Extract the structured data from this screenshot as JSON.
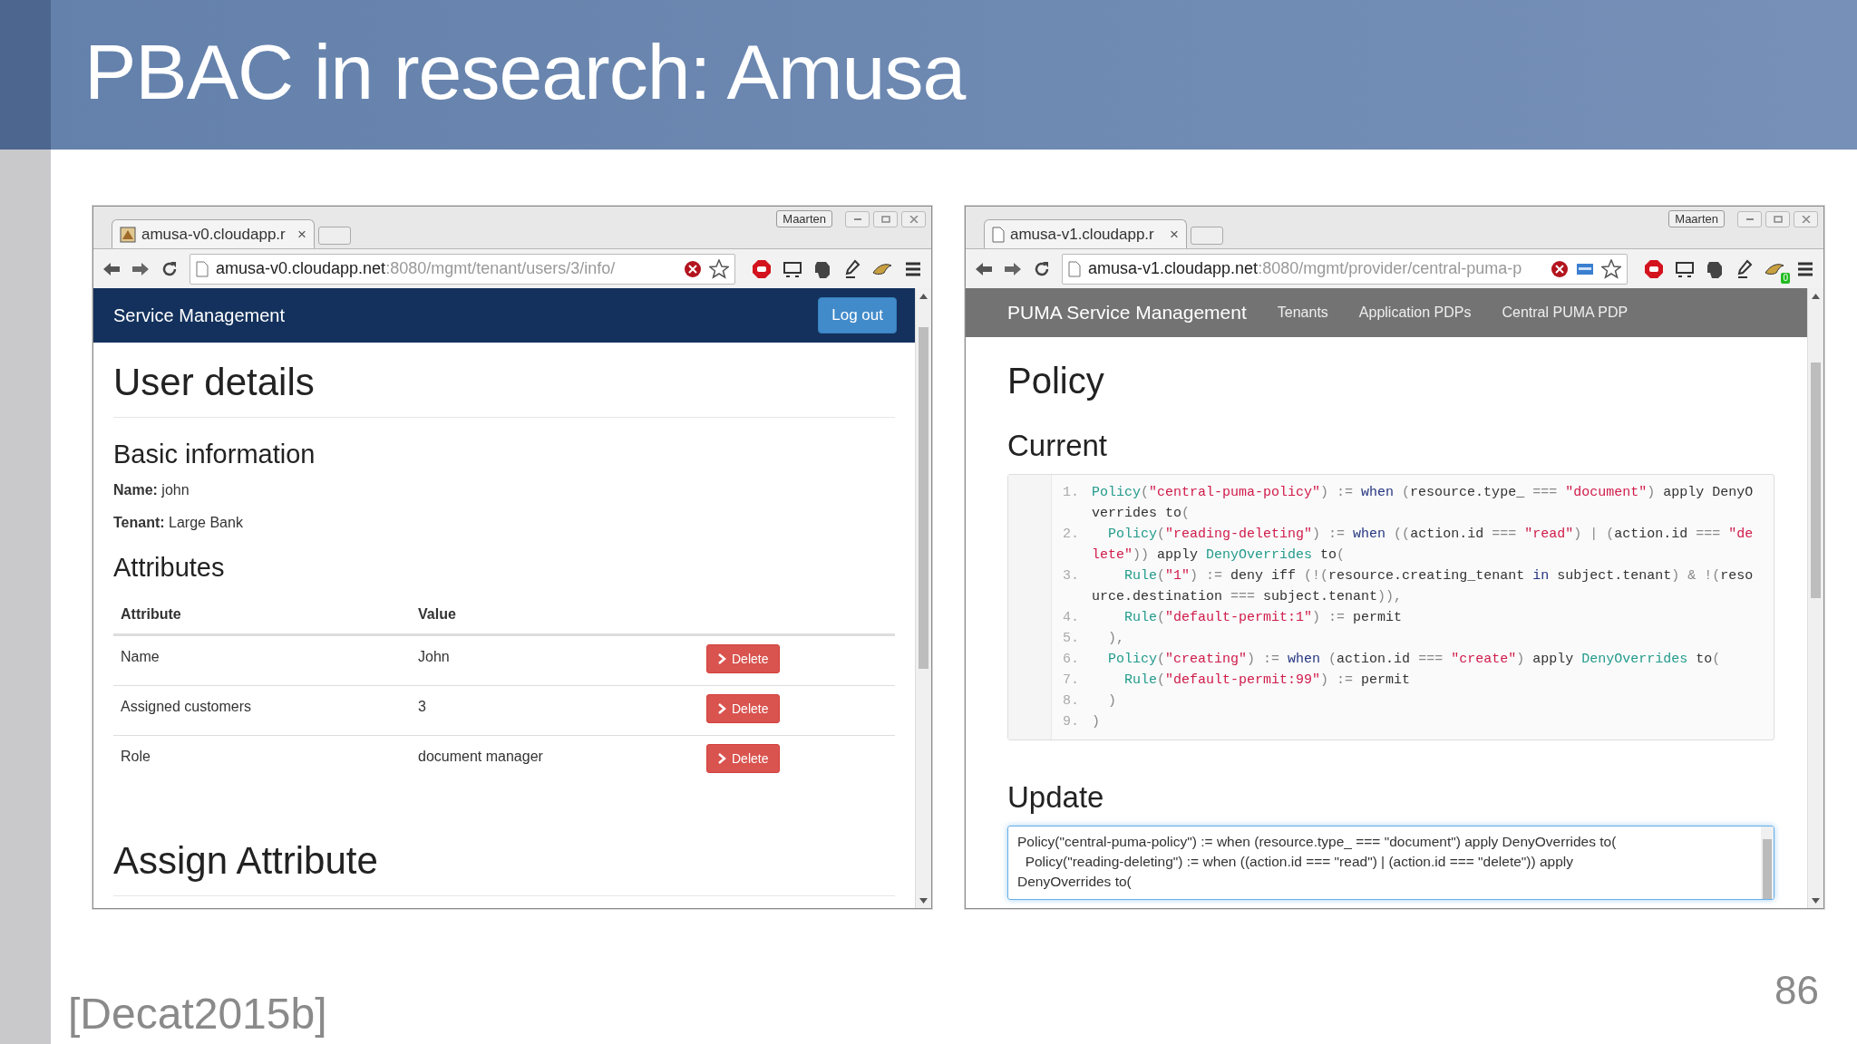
{
  "slide": {
    "title": "PBAC in research: Amusa",
    "citation": "[Decat2015b]",
    "page_number": "86"
  },
  "left_browser": {
    "profile": "Maarten",
    "tab": {
      "title": "amusa-v0.cloudapp.r",
      "close": "×"
    },
    "address": {
      "host": "amusa-v0.cloudapp.net",
      "path": ":8080/mgmt/tenant/users/3/info/"
    },
    "navbar": {
      "brand": "Service Management",
      "logout": "Log out"
    },
    "page": {
      "title": "User details",
      "basic_heading": "Basic information",
      "fields": [
        "**Name:** john",
        "**Tenant:** Large Bank"
      ],
      "attributes_heading": "Attributes",
      "table": {
        "columns": [
          "Attribute",
          "Value"
        ],
        "rows": [
          {
            "attribute": "Name",
            "value": "John",
            "action": "Delete"
          },
          {
            "attribute": "Assigned customers",
            "value": "3",
            "action": "Delete"
          },
          {
            "attribute": "Role",
            "value": "document manager",
            "action": "Delete"
          }
        ]
      },
      "assign_heading": "Assign Attribute"
    }
  },
  "right_browser": {
    "profile": "Maarten",
    "tab": {
      "title": "amusa-v1.cloudapp.r",
      "close": "×"
    },
    "address": {
      "host": "amusa-v1.cloudapp.net",
      "path": ":8080/mgmt/provider/central-puma-p"
    },
    "extension_badge": "0",
    "navbar": {
      "brand": "PUMA Service Management",
      "links": [
        "Tenants",
        "Application PDPs",
        "Central PUMA PDP"
      ]
    },
    "page": {
      "title": "Policy",
      "current_heading": "Current",
      "code": [
        {
          "number": "1.",
          "tokens": [
            {
              "kind": "fn",
              "text": "Policy"
            },
            {
              "kind": "op",
              "text": "("
            },
            {
              "kind": "str",
              "text": "\"central-puma-policy\""
            },
            {
              "kind": "op",
              "text": ") := "
            },
            {
              "kind": "kw",
              "text": "when"
            },
            {
              "kind": "op",
              "text": " ("
            },
            {
              "kind": "plain",
              "text": "resource.type_ "
            },
            {
              "kind": "op",
              "text": "=== "
            },
            {
              "kind": "str",
              "text": "\"document\""
            },
            {
              "kind": "op",
              "text": ") "
            },
            {
              "kind": "plain",
              "text": "apply DenyOverrides to"
            },
            {
              "kind": "op",
              "text": "("
            }
          ]
        },
        {
          "number": "2.",
          "tokens": [
            {
              "kind": "fn",
              "text": "  Policy"
            },
            {
              "kind": "op",
              "text": "("
            },
            {
              "kind": "str",
              "text": "\"reading-deleting\""
            },
            {
              "kind": "op",
              "text": ") := "
            },
            {
              "kind": "kw",
              "text": "when"
            },
            {
              "kind": "op",
              "text": " (("
            },
            {
              "kind": "plain",
              "text": "action.id "
            },
            {
              "kind": "op",
              "text": "=== "
            },
            {
              "kind": "str",
              "text": "\"read\""
            },
            {
              "kind": "op",
              "text": ") | ("
            },
            {
              "kind": "plain",
              "text": "action.id "
            },
            {
              "kind": "op",
              "text": "=== "
            },
            {
              "kind": "str",
              "text": "\"delete\""
            },
            {
              "kind": "op",
              "text": ")) "
            },
            {
              "kind": "plain",
              "text": "apply "
            },
            {
              "kind": "fn",
              "text": "DenyOverrides"
            },
            {
              "kind": "plain",
              "text": " to"
            },
            {
              "kind": "op",
              "text": "("
            }
          ]
        },
        {
          "number": "3.",
          "tokens": [
            {
              "kind": "fn",
              "text": "    Rule"
            },
            {
              "kind": "op",
              "text": "("
            },
            {
              "kind": "str",
              "text": "\"1\""
            },
            {
              "kind": "op",
              "text": ") := "
            },
            {
              "kind": "plain",
              "text": "deny iff "
            },
            {
              "kind": "op",
              "text": "(!("
            },
            {
              "kind": "plain",
              "text": "resource.creating_tenant "
            },
            {
              "kind": "kw",
              "text": "in"
            },
            {
              "kind": "plain",
              "text": " subject.tenant"
            },
            {
              "kind": "op",
              "text": ") & !("
            },
            {
              "kind": "plain",
              "text": "resource.destination "
            },
            {
              "kind": "op",
              "text": "=== "
            },
            {
              "kind": "plain",
              "text": "subject.tenant"
            },
            {
              "kind": "op",
              "text": ")),"
            }
          ]
        },
        {
          "number": "4.",
          "tokens": [
            {
              "kind": "fn",
              "text": "    Rule"
            },
            {
              "kind": "op",
              "text": "("
            },
            {
              "kind": "str",
              "text": "\"default-permit:1\""
            },
            {
              "kind": "op",
              "text": ") := "
            },
            {
              "kind": "plain",
              "text": "permit"
            }
          ]
        },
        {
          "number": "5.",
          "tokens": [
            {
              "kind": "op",
              "text": "  ),"
            }
          ]
        },
        {
          "number": "6.",
          "tokens": [
            {
              "kind": "fn",
              "text": "  Policy"
            },
            {
              "kind": "op",
              "text": "("
            },
            {
              "kind": "str",
              "text": "\"creating\""
            },
            {
              "kind": "op",
              "text": ") := "
            },
            {
              "kind": "kw",
              "text": "when"
            },
            {
              "kind": "op",
              "text": " ("
            },
            {
              "kind": "plain",
              "text": "action.id "
            },
            {
              "kind": "op",
              "text": "=== "
            },
            {
              "kind": "str",
              "text": "\"create\""
            },
            {
              "kind": "op",
              "text": ") "
            },
            {
              "kind": "plain",
              "text": "apply "
            },
            {
              "kind": "fn",
              "text": "DenyOverrides"
            },
            {
              "kind": "plain",
              "text": " to"
            },
            {
              "kind": "op",
              "text": "("
            }
          ]
        },
        {
          "number": "7.",
          "tokens": [
            {
              "kind": "fn",
              "text": "    Rule"
            },
            {
              "kind": "op",
              "text": "("
            },
            {
              "kind": "str",
              "text": "\"default-permit:99\""
            },
            {
              "kind": "op",
              "text": ") := "
            },
            {
              "kind": "plain",
              "text": "permit"
            }
          ]
        },
        {
          "number": "8.",
          "tokens": [
            {
              "kind": "op",
              "text": "  )"
            }
          ]
        },
        {
          "number": "9.",
          "tokens": [
            {
              "kind": "op",
              "text": ")"
            }
          ]
        }
      ],
      "update_heading": "Update",
      "update_value": "Policy(\"central-puma-policy\") := when (resource.type_ === \"document\") apply DenyOverrides to(\n  Policy(\"reading-deleting\") := when ((action.id === \"read\") | (action.id === \"delete\")) apply DenyOverrides to("
    }
  }
}
